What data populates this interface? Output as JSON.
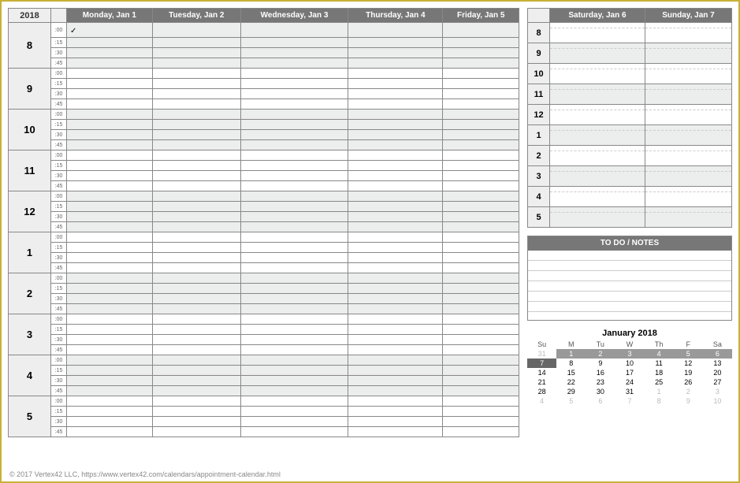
{
  "year": "2018",
  "weekdays": [
    {
      "label": "Monday, Jan 1"
    },
    {
      "label": "Tuesday, Jan 2"
    },
    {
      "label": "Wednesday, Jan 3"
    },
    {
      "label": "Thursday, Jan 4"
    },
    {
      "label": "Friday, Jan 5"
    }
  ],
  "weekday_hours": [
    "8",
    "9",
    "10",
    "11",
    "12",
    "1",
    "2",
    "3",
    "4",
    "5"
  ],
  "minute_marks": [
    ":00",
    ":15",
    ":30",
    ":45"
  ],
  "weekend_days": [
    {
      "label": "Saturday, Jan 6"
    },
    {
      "label": "Sunday, Jan 7"
    }
  ],
  "weekend_hours": [
    "8",
    "9",
    "10",
    "11",
    "12",
    "1",
    "2",
    "3",
    "4",
    "5"
  ],
  "first_cell_check": "✓",
  "todo_header": "TO DO  /  NOTES",
  "mini_cal": {
    "title": "January 2018",
    "day_headers": [
      "Su",
      "M",
      "Tu",
      "W",
      "Th",
      "F",
      "Sa"
    ],
    "weeks": [
      [
        {
          "d": "31",
          "g": true
        },
        {
          "d": "1",
          "hl": true
        },
        {
          "d": "2",
          "hl": true
        },
        {
          "d": "3",
          "hl": true
        },
        {
          "d": "4",
          "hl": true
        },
        {
          "d": "5",
          "hl": true
        },
        {
          "d": "6",
          "hl": true
        }
      ],
      [
        {
          "d": "7",
          "today": true
        },
        {
          "d": "8"
        },
        {
          "d": "9"
        },
        {
          "d": "10"
        },
        {
          "d": "11"
        },
        {
          "d": "12"
        },
        {
          "d": "13"
        }
      ],
      [
        {
          "d": "14"
        },
        {
          "d": "15"
        },
        {
          "d": "16"
        },
        {
          "d": "17"
        },
        {
          "d": "18"
        },
        {
          "d": "19"
        },
        {
          "d": "20"
        }
      ],
      [
        {
          "d": "21"
        },
        {
          "d": "22"
        },
        {
          "d": "23"
        },
        {
          "d": "24"
        },
        {
          "d": "25"
        },
        {
          "d": "26"
        },
        {
          "d": "27"
        }
      ],
      [
        {
          "d": "28"
        },
        {
          "d": "29"
        },
        {
          "d": "30"
        },
        {
          "d": "31"
        },
        {
          "d": "1",
          "g": true
        },
        {
          "d": "2",
          "g": true
        },
        {
          "d": "3",
          "g": true
        }
      ],
      [
        {
          "d": "4",
          "g": true
        },
        {
          "d": "5",
          "g": true
        },
        {
          "d": "6",
          "g": true
        },
        {
          "d": "7",
          "g": true
        },
        {
          "d": "8",
          "g": true
        },
        {
          "d": "9",
          "g": true
        },
        {
          "d": "10",
          "g": true
        }
      ]
    ]
  },
  "footer": "© 2017 Vertex42 LLC, https://www.vertex42.com/calendars/appointment-calendar.html"
}
